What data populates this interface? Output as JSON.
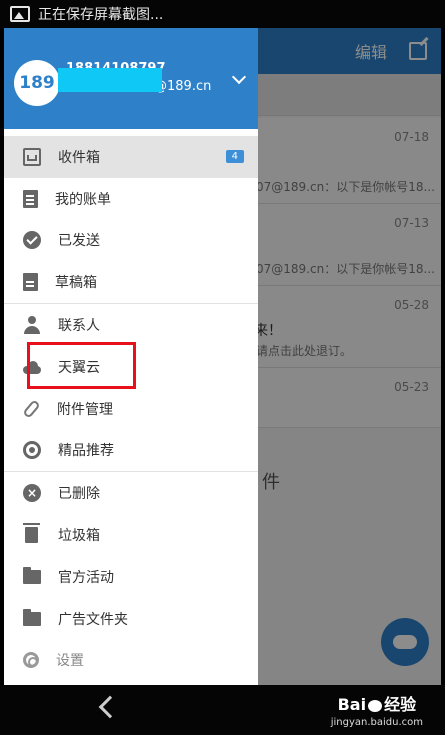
{
  "status_bar": {
    "notification": "正在保存屏幕截图..."
  },
  "mail_list": {
    "topbar_edit_label": "编辑",
    "rows": [
      {
        "date": "07-18",
        "snippet": "07@189.cn：以下是你帐号18..."
      },
      {
        "date": "07-13",
        "snippet": "07@189.cn：以下是你帐号18..."
      },
      {
        "date": "05-28",
        "title": "来！",
        "snippet": "请点击此处退订。"
      },
      {
        "date": "05-23"
      }
    ],
    "partial_text": "件"
  },
  "drawer": {
    "account": {
      "logo_text": "189",
      "phone": "18814108797",
      "email_suffix": "@189.cn"
    },
    "items": [
      {
        "label": "收件箱",
        "icon": "inbox-icon",
        "badge": "4"
      },
      {
        "label": "我的账单",
        "icon": "bill-icon"
      },
      {
        "label": "已发送",
        "icon": "sent-check-icon"
      },
      {
        "label": "草稿箱",
        "icon": "draft-icon"
      },
      {
        "label": "联系人",
        "icon": "contacts-icon"
      },
      {
        "label": "天翼云",
        "icon": "cloud-icon"
      },
      {
        "label": "附件管理",
        "icon": "attachment-icon"
      },
      {
        "label": "精品推荐",
        "icon": "recommend-icon"
      },
      {
        "label": "已删除",
        "icon": "deleted-icon"
      },
      {
        "label": "垃圾箱",
        "icon": "trash-icon"
      },
      {
        "label": "官方活动",
        "icon": "folder-icon"
      },
      {
        "label": "广告文件夹",
        "icon": "folder-icon"
      },
      {
        "label": "设置",
        "icon": "settings-icon"
      }
    ]
  },
  "watermark": {
    "brand_left": "Bai",
    "brand_right": "经验",
    "url": "jingyan.baidu.com"
  },
  "colors": {
    "accent": "#2e80c8",
    "highlight": "#e8101a",
    "redaction": "#0fc8f5"
  }
}
